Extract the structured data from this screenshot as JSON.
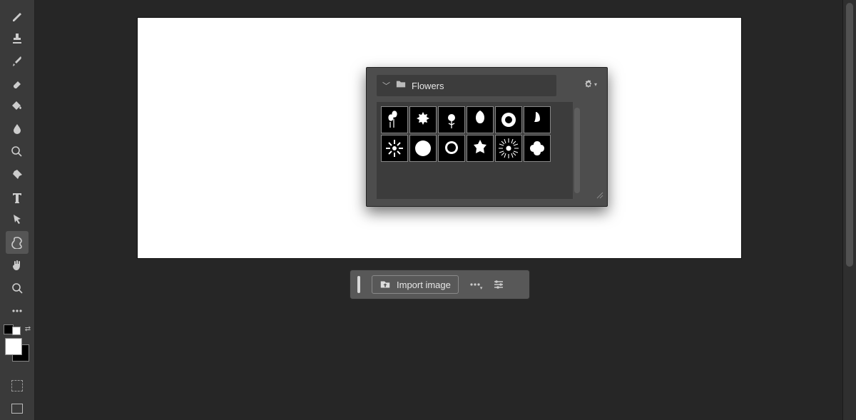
{
  "tools": [
    {
      "name": "pencil-tool",
      "icon": "pencil"
    },
    {
      "name": "stamp-tool",
      "icon": "stamp"
    },
    {
      "name": "brush-tool",
      "icon": "brush"
    },
    {
      "name": "eraser-tool",
      "icon": "eraser"
    },
    {
      "name": "bucket-tool",
      "icon": "bucket"
    },
    {
      "name": "blur-tool",
      "icon": "drop"
    },
    {
      "name": "dodge-tool",
      "icon": "lollipop"
    },
    {
      "name": "pen-tool",
      "icon": "pen"
    },
    {
      "name": "text-tool",
      "icon": "text"
    },
    {
      "name": "pointer-tool",
      "icon": "pointer"
    },
    {
      "name": "shape-tool",
      "icon": "blob",
      "selected": true
    },
    {
      "name": "hand-tool",
      "icon": "hand"
    },
    {
      "name": "zoom-tool",
      "icon": "search"
    },
    {
      "name": "more-tool",
      "icon": "dots"
    }
  ],
  "swatches": {
    "foreground": "#ffffff",
    "background": "#000000"
  },
  "shapes_panel": {
    "folder_label": "Flowers",
    "shapes": [
      "flower-bouquet",
      "flower-sprig",
      "flower-cluster",
      "flower-lily",
      "flower-blossom",
      "flower-tulip",
      "flower-stems",
      "flower-lotus",
      "flower-rose",
      "flower-camellia",
      "flower-daisy",
      "flower-succulent"
    ]
  },
  "contextbar": {
    "import_label": "Import image"
  }
}
